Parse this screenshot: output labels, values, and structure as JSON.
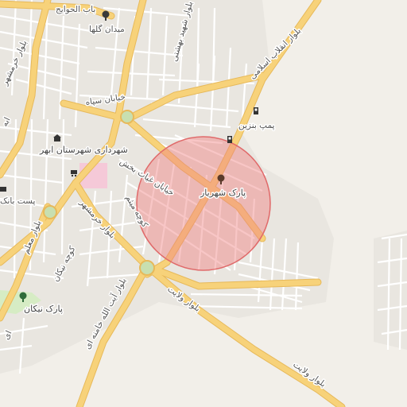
{
  "map": {
    "radius_circle_color": "#f08080",
    "road_color": "#f7d27a",
    "road_outline_color": "#e7b95a",
    "minor_road_color": "#ffffff",
    "background_color": "#f2efe9",
    "labels": {
      "bab_al_havayej": "باب الحوایج",
      "meydan_golha": "میدان گلها",
      "blvd_shahid_beheshti": "بلوار شهید بهشتی",
      "blvd_enghelab": "بلوار انقلاب اسلامی",
      "khiaban_sepah": "خیابان سپاه",
      "pump_benzin": "پمپ بنزین",
      "shahrdari": "شهرداری شهرستان ابهر",
      "khiaban_ghias": "خیابان غیاث بخش",
      "park_shahryar": "پارک شهریار",
      "post_bank": "پست بانک",
      "blvd_khoramshahr": "بلوار خرمشهر",
      "kucheh_meysam": "کوچه میثم",
      "kucheh_nikan": "کوچه نیکان",
      "blvd_moalem": "بلوار معلم",
      "blvd_ayatollah": "بلوار آیت الله خامنه ای",
      "blvd_velayat_1": "بلوار ولایت",
      "blvd_velayat_2": "بلوار ولایت",
      "park_nikan": "پارک نیکان",
      "blvd_khoramshahr_left": "بلوار خرمشهر",
      "left_edge_a": "ابه",
      "left_edge_b": "ای"
    },
    "icons": {
      "meydan_golha": "tree-icon",
      "park_shahryar": "tree-icon",
      "park_nikan": "tree-icon",
      "pump_benzin": "fuel-icon",
      "shahrdari": "town-hall-icon",
      "shop": "shopping-cart-icon",
      "post": "mail-icon"
    }
  }
}
